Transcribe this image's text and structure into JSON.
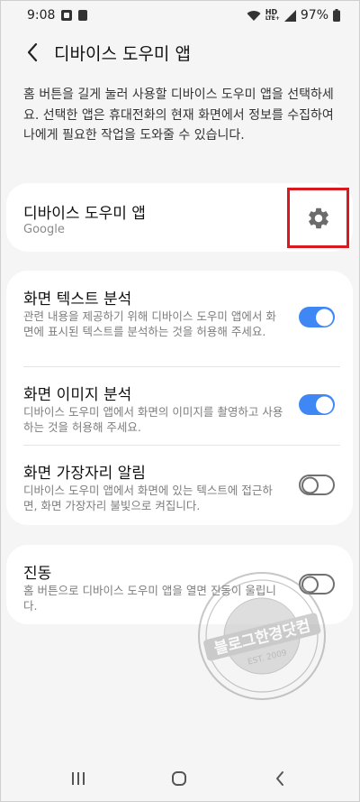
{
  "status_bar": {
    "time": "9:08",
    "network": "HD",
    "network_sub": "LTE+",
    "battery": "97%"
  },
  "header": {
    "title": "디바이스 도우미 앱",
    "back_icon": "chevron-left-icon"
  },
  "description": "홈 버튼을 길게 눌러 사용할 디바이스 도우미 앱을 선택하세요. 선택한 앱은 휴대전화의 현재 화면에서 정보를 수집하여 나에게 필요한 작업을 도와줄 수 있습니다.",
  "assistant": {
    "name": "디바이스 도우미 앱",
    "value": "Google",
    "settings_icon": "gear-icon",
    "highlight_color": "#d9191f"
  },
  "analysis": {
    "items": [
      {
        "title": "화면 텍스트 분석",
        "desc": "관련 내용을 제공하기 위해 디바이스 도우미 앱에서 화면에 표시된 텍스트를 분석하는 것을 허용해 주세요.",
        "enabled": true
      },
      {
        "title": "화면 이미지 분석",
        "desc": "디바이스 도우미 앱에서 화면의 이미지를 촬영하고 사용하는 것을 허용해 주세요.",
        "enabled": true
      },
      {
        "title": "화면 가장자리 알림",
        "desc": "디바이스 도우미 앱에서 화면에 있는 텍스트에 접근하면, 화면 가장자리 불빛으로 켜집니다.",
        "enabled": false
      }
    ]
  },
  "vibration": {
    "title": "진동",
    "desc": "홈 버튼으로 디바이스 도우미 앱을 열면 진동이 울립니다.",
    "enabled": false
  },
  "watermark": {
    "main_text": "블로그한경닷컴",
    "sub_text": "EST. 2009"
  },
  "colors": {
    "accent": "#3e87f5",
    "background": "#f5f5f5",
    "card": "#ffffff"
  },
  "nav_bar": {
    "recent_icon": "recent-apps-icon",
    "home_icon": "home-icon",
    "back_icon": "back-icon"
  }
}
